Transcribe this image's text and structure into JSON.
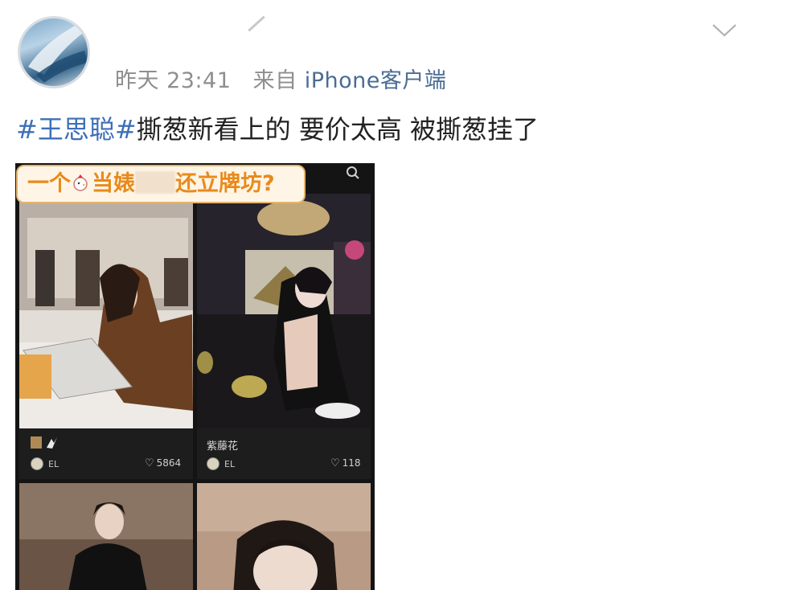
{
  "post": {
    "time": "昨天 23:41",
    "source_prefix": "来自",
    "source": "iPhone客户端",
    "tag1": "#王思聪#",
    "text": "撕葱新看上的 要价太高 被撕葱挂了"
  },
  "screenshot": {
    "banner_before": "一个",
    "banner_mid": "当婊",
    "banner_after": "还立牌坊?",
    "cards": [
      {
        "caption": "",
        "user": "EL",
        "likes": "5864"
      },
      {
        "caption": "紫藤花",
        "user": "EL",
        "likes": "118"
      }
    ]
  },
  "icons": {
    "avatar": "avatar-icon",
    "expand": "chevron-down-icon",
    "search": "search-icon",
    "heart": "heart-icon"
  },
  "colors": {
    "tag": "#3e6fb6",
    "meta": "#8e8e8e",
    "banner_text": "#e88a1c",
    "banner_border": "#e6b46c"
  }
}
